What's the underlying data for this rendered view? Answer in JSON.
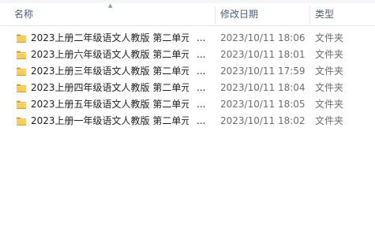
{
  "columns": {
    "name": "名称",
    "date": "修改日期",
    "type": "类型"
  },
  "ellipsis": "...",
  "files": [
    {
      "name": "2023上册二年级语文人教版 第二单元",
      "date": "2023/10/11 18:06",
      "type": "文件夹"
    },
    {
      "name": "2023上册六年级语文人教版 第二单元",
      "date": "2023/10/11 18:01",
      "type": "文件夹"
    },
    {
      "name": "2023上册三年级语文人教版 第二单元",
      "date": "2023/10/11 17:59",
      "type": "文件夹"
    },
    {
      "name": "2023上册四年级语文人教版 第二单元",
      "date": "2023/10/11 18:04",
      "type": "文件夹"
    },
    {
      "name": "2023上册五年级语文人教版 第二单元",
      "date": "2023/10/11 18:05",
      "type": "文件夹"
    },
    {
      "name": "2023上册一年级语文人教版 第二单元",
      "date": "2023/10/11 18:02",
      "type": "文件夹"
    }
  ],
  "icon": "folder-icon"
}
